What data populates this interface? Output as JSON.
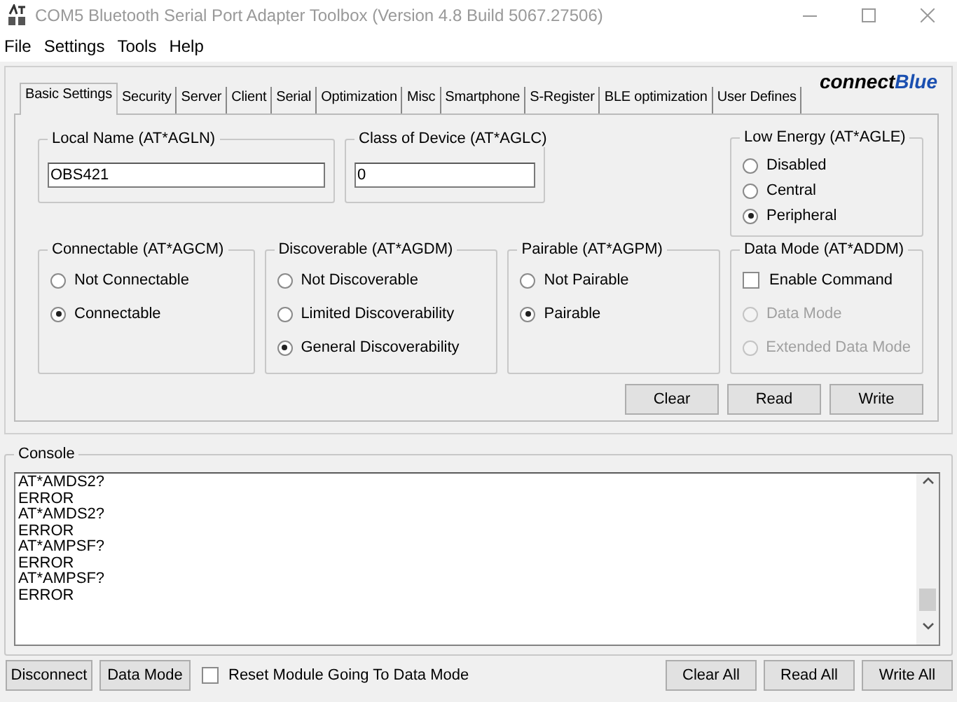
{
  "window": {
    "title": "COM5 Bluetooth Serial Port Adapter Toolbox (Version 4.8 Build 5067.27506)"
  },
  "menu": [
    "File",
    "Settings",
    "Tools",
    "Help"
  ],
  "logo": {
    "text": "connect",
    "accent": "Blue"
  },
  "tabs": [
    {
      "label": "Basic Settings",
      "selected": true
    },
    {
      "label": "Security",
      "selected": false
    },
    {
      "label": "Server",
      "selected": false
    },
    {
      "label": "Client",
      "selected": false
    },
    {
      "label": "Serial",
      "selected": false
    },
    {
      "label": "Optimization",
      "selected": false
    },
    {
      "label": "Misc",
      "selected": false
    },
    {
      "label": "Smartphone",
      "selected": false
    },
    {
      "label": "S-Register",
      "selected": false
    },
    {
      "label": "BLE optimization",
      "selected": false
    },
    {
      "label": "User Defines",
      "selected": false
    }
  ],
  "local_name": {
    "title": "Local Name (AT*AGLN)",
    "value": "OBS421"
  },
  "class_of_device": {
    "title": "Class of Device (AT*AGLC)",
    "value": "0"
  },
  "low_energy": {
    "title": "Low Energy (AT*AGLE)",
    "options": [
      {
        "label": "Disabled",
        "selected": false
      },
      {
        "label": "Central",
        "selected": false
      },
      {
        "label": "Peripheral",
        "selected": true
      }
    ]
  },
  "connectable": {
    "title": "Connectable (AT*AGCM)",
    "options": [
      {
        "label": "Not Connectable",
        "selected": false
      },
      {
        "label": "Connectable",
        "selected": true
      }
    ]
  },
  "discoverable": {
    "title": "Discoverable (AT*AGDM)",
    "options": [
      {
        "label": "Not Discoverable",
        "selected": false
      },
      {
        "label": "Limited Discoverability",
        "selected": false
      },
      {
        "label": "General Discoverability",
        "selected": true
      }
    ]
  },
  "pairable": {
    "title": "Pairable (AT*AGPM)",
    "options": [
      {
        "label": "Not Pairable",
        "selected": false
      },
      {
        "label": "Pairable",
        "selected": true
      }
    ]
  },
  "data_mode": {
    "title": "Data Mode (AT*ADDM)",
    "enable_command": {
      "label": "Enable Command",
      "checked": false
    },
    "options": [
      {
        "label": "Data Mode",
        "selected": false,
        "disabled": true
      },
      {
        "label": "Extended Data Mode",
        "selected": false,
        "disabled": true
      }
    ]
  },
  "panel_buttons": [
    "Clear",
    "Read",
    "Write"
  ],
  "console": {
    "title": "Console",
    "lines": [
      "AT*AMDS2?",
      "ERROR",
      "AT*AMDS2?",
      "ERROR",
      "AT*AMPSF?",
      "ERROR",
      "AT*AMPSF?",
      "ERROR"
    ]
  },
  "bottom": {
    "left_buttons": [
      "Disconnect",
      "Data Mode"
    ],
    "reset_option": {
      "label": "Reset Module Going To Data Mode",
      "checked": false
    },
    "right_buttons": [
      "Clear All",
      "Read All",
      "Write All"
    ]
  }
}
